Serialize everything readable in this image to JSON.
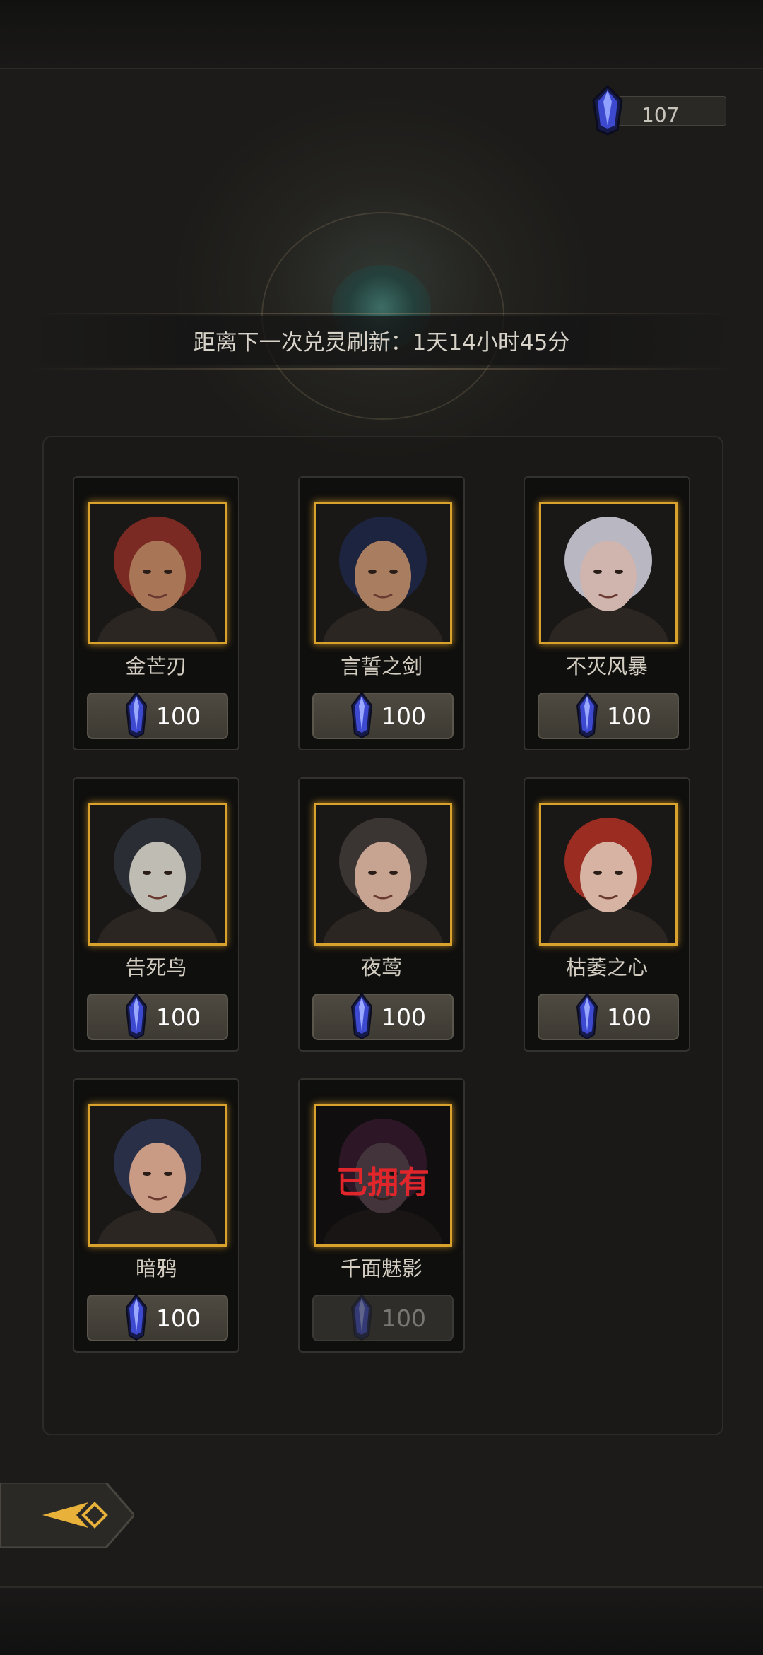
{
  "currency": {
    "icon": "crystal-icon",
    "amount": "107"
  },
  "refresh": {
    "text": "距离下一次兑灵刷新：1天14小时45分"
  },
  "heroes": [
    {
      "name": "金芒刃",
      "price": "100",
      "owned": false,
      "hair": "#7a2a22",
      "skin": "#a87656"
    },
    {
      "name": "言誓之剑",
      "price": "100",
      "owned": false,
      "hair": "#1d2440",
      "skin": "#a97d60"
    },
    {
      "name": "不灭风暴",
      "price": "100",
      "owned": false,
      "hair": "#b9b7c2",
      "skin": "#d0b4ae"
    },
    {
      "name": "告死鸟",
      "price": "100",
      "owned": false,
      "hair": "#2a2d33",
      "skin": "#bfbcb3"
    },
    {
      "name": "夜莺",
      "price": "100",
      "owned": false,
      "hair": "#3a3533",
      "skin": "#c7a492"
    },
    {
      "name": "枯萎之心",
      "price": "100",
      "owned": false,
      "hair": "#9a2c22",
      "skin": "#d6b3a3"
    },
    {
      "name": "暗鸦",
      "price": "100",
      "owned": false,
      "hair": "#2a2f48",
      "skin": "#c99b85"
    },
    {
      "name": "千面魅影",
      "price": "100",
      "owned": true,
      "owned_label": "已拥有",
      "hair": "#5a2a4a",
      "skin": "#8a6a7a"
    }
  ],
  "colors": {
    "frame_gold": "#d9a22c",
    "owned_red": "#e0262b",
    "background": "#1c1b19"
  },
  "back_button": {
    "icon": "back-arrow-icon"
  }
}
